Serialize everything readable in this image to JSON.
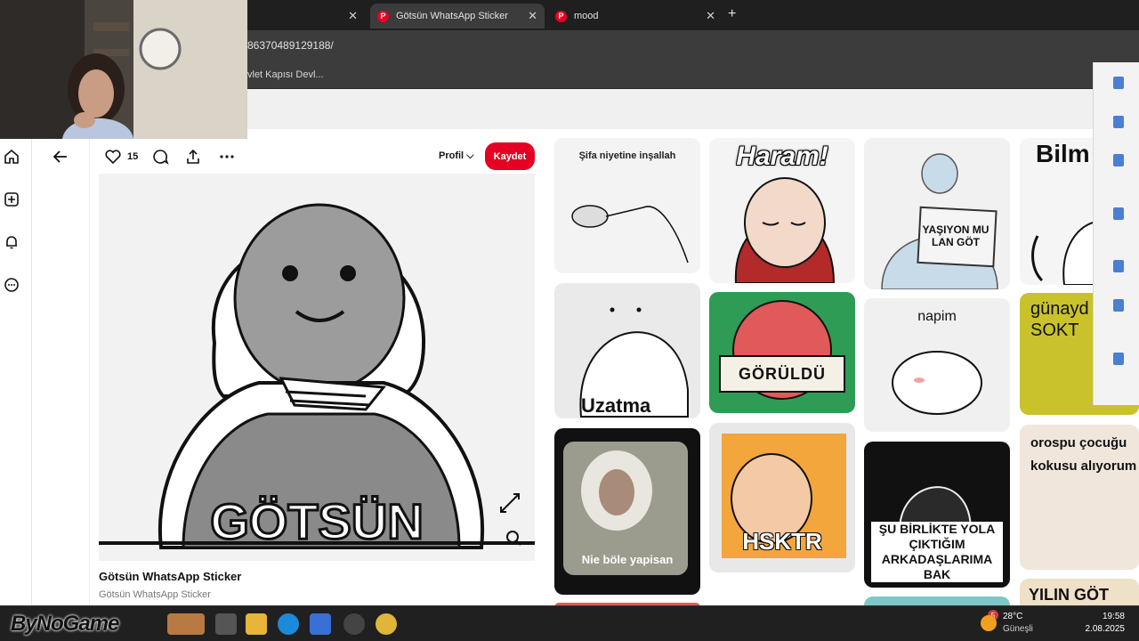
{
  "browser": {
    "tabs": [
      {
        "label": "",
        "active": false
      },
      {
        "label": "Götsün WhatsApp Sticker",
        "active": true
      },
      {
        "label": "mood",
        "active": false
      }
    ],
    "url_fragment": "86370489129188/",
    "bookmark": "vlet Kapısı Devl..."
  },
  "pin": {
    "like_count": "15",
    "profile_label": "Profil",
    "save_label": "Kaydet",
    "sticker_text": "GÖTSÜN",
    "title": "Götsün WhatsApp Sticker",
    "subtitle": "Götsün WhatsApp Sticker"
  },
  "feed": {
    "tile1_caption": "Şifa niyetine inşallah",
    "tile2_caption": "Haram!",
    "tile3_caption": "YAŞIYON MU LAN GÖT",
    "tile4_caption": "Bilm",
    "tile5_caption": "Uzatma",
    "tile6_caption": "GÖRÜLDÜ",
    "tile7_caption": "napim",
    "tile8_caption": "günayd SOKT",
    "tile9_caption": "Nie böle yapisan",
    "tile10_caption": "HSKTR",
    "tile11_caption": "ŞU BİRLİKTE YOLA ÇIKTIĞIM ARKADAŞLARIMA BAK",
    "tile12_caption": "orospu çocuğu kokusu alıyorum",
    "tile13_caption": "YILIN GÖT"
  },
  "taskbar": {
    "watermark": "ByNoGame",
    "temperature": "28°C",
    "weather": "Güneşli",
    "time": "19:58",
    "date": "2.08.2025",
    "notification_count": "5"
  },
  "colors": {
    "brand_red": "#e60023",
    "chrome_dark": "#1f1f1f",
    "chrome_mid": "#3c3c3c"
  }
}
